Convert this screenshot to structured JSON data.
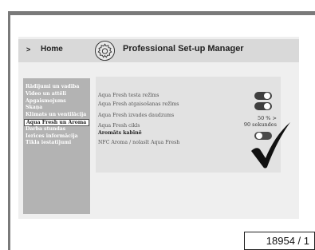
{
  "header": {
    "home_arrow": ">",
    "home_label": "Home",
    "title": "Professional Set-up Manager",
    "settings_icon": "gear-icon"
  },
  "sidebar": {
    "items": [
      {
        "label": "Rādījumi un vadība",
        "active": false
      },
      {
        "label": "Video un attēli",
        "active": false
      },
      {
        "label": "Apgaismojums",
        "active": false
      },
      {
        "label": "Skaņa",
        "active": false
      },
      {
        "label": "Klimats un ventilācija",
        "active": false
      },
      {
        "label": "Aqua Fresh un Aroma",
        "active": true
      },
      {
        "label": "Darba stundas",
        "active": false
      },
      {
        "label": "Ierīces informācija",
        "active": false
      },
      {
        "label": "Tīkla iestatījumi",
        "active": false
      }
    ]
  },
  "panel": {
    "rows": [
      {
        "label": "Aqua Fresh testa režīms",
        "control": "toggle-off"
      },
      {
        "label": "Aqua Fresh atgaisošanas režīms",
        "control": "toggle-off"
      },
      {
        "label": "Aqua Fresh izvades daudzums",
        "value": "50 % >"
      },
      {
        "label": "Aqua Fresh cikls",
        "value": "90 sekundes"
      },
      {
        "label": "Aromāts kabīnē",
        "control": "toggle-on",
        "bold": true
      },
      {
        "label": "NFC Aroma / nolasīt Aqua Fresh"
      }
    ]
  },
  "reference_number": "18954 / 1",
  "colors": {
    "frame": "#7a7a7a",
    "header_bg": "#d9d9d9",
    "sidebar_bg": "#b3b3b3",
    "panel_bg": "#e2e2e2",
    "toggle": "#3f3f3f"
  }
}
